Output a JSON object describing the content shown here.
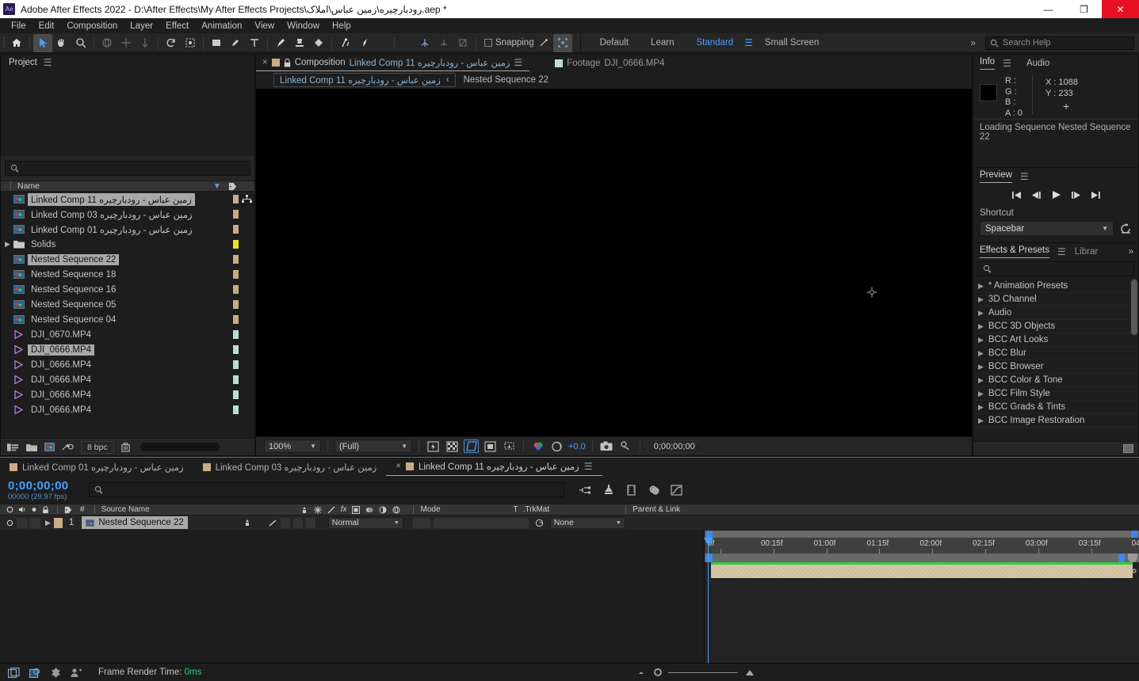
{
  "window": {
    "title": "Adobe After Effects 2022 - D:\\After Effects\\My After Effects Projects\\رودبارچیره\\زمین عباس\\املاک.aep *",
    "logo": "Ae",
    "minimize": "—",
    "maximize": "❐",
    "close": "✕"
  },
  "menubar": {
    "items": [
      "File",
      "Edit",
      "Composition",
      "Layer",
      "Effect",
      "Animation",
      "View",
      "Window",
      "Help"
    ]
  },
  "toolbar": {
    "snapping_label": "Snapping",
    "workspaces": [
      {
        "label": "Default",
        "current": false
      },
      {
        "label": "Learn",
        "current": false
      },
      {
        "label": "Standard",
        "current": true
      },
      {
        "label": "Small Screen",
        "current": false
      }
    ],
    "overflow": "»"
  },
  "search_help": {
    "placeholder": "Search Help",
    "value": "Search Help"
  },
  "project": {
    "tab_label": "Project",
    "menu_icon": "hamburger-icon",
    "search_placeholder": "",
    "column_header": "Name",
    "items": [
      {
        "name": "زمین عباس - رودبارچیره Linked Comp 11",
        "type": "comp",
        "label_color": "#c9ab85",
        "selected": true,
        "rtl": true
      },
      {
        "name": "زمین عباس - رودبارچیره Linked Comp 03",
        "type": "comp",
        "label_color": "#c9ab85",
        "selected": false,
        "rtl": true
      },
      {
        "name": "زمین عباس - رودبارچیره Linked Comp 01",
        "type": "comp",
        "label_color": "#c9ab85",
        "selected": false,
        "rtl": true
      },
      {
        "name": "Solids",
        "type": "folder",
        "label_color": "#ece02c",
        "selected": false,
        "rtl": false
      },
      {
        "name": "Nested Sequence 22",
        "type": "comp",
        "label_color": "#c9ab85",
        "selected": true,
        "rtl": false
      },
      {
        "name": "Nested Sequence 18",
        "type": "comp",
        "label_color": "#c9ab85",
        "selected": false,
        "rtl": false
      },
      {
        "name": "Nested Sequence 16",
        "type": "comp",
        "label_color": "#c9ab85",
        "selected": false,
        "rtl": false
      },
      {
        "name": "Nested Sequence 05",
        "type": "comp",
        "label_color": "#c9ab85",
        "selected": false,
        "rtl": false
      },
      {
        "name": "Nested Sequence 04",
        "type": "comp",
        "label_color": "#c9ab85",
        "selected": false,
        "rtl": false
      },
      {
        "name": "DJI_0670.MP4",
        "type": "footage",
        "label_color": "#b9ded9",
        "selected": false,
        "rtl": false
      },
      {
        "name": "DJI_0666.MP4",
        "type": "footage",
        "label_color": "#b9ded9",
        "selected": true,
        "rtl": false
      },
      {
        "name": "DJI_0666.MP4",
        "type": "footage",
        "label_color": "#b9ded9",
        "selected": false,
        "rtl": false
      },
      {
        "name": "DJI_0666.MP4",
        "type": "footage",
        "label_color": "#b9ded9",
        "selected": false,
        "rtl": false
      },
      {
        "name": "DJI_0666.MP4",
        "type": "footage",
        "label_color": "#b9ded9",
        "selected": false,
        "rtl": false
      },
      {
        "name": "DJI_0666.MP4",
        "type": "footage",
        "label_color": "#b9ded9",
        "selected": false,
        "rtl": false
      }
    ],
    "bottom": {
      "bit_depth": "8 bpc"
    }
  },
  "composition": {
    "tabs": [
      {
        "prefix": "Composition",
        "label": "زمین عباس - رودبارچیره Linked Comp 11",
        "active": true,
        "closable": true,
        "locked": true,
        "swatch": "#c9ab85"
      },
      {
        "prefix": "Footage",
        "label": "DJI_0666.MP4",
        "active": false,
        "closable": false,
        "locked": false,
        "swatch": "#b9ded9"
      }
    ],
    "breadcrumb": {
      "chip": "زمین عباس - رودبارچیره Linked Comp 11",
      "arrow": "‹",
      "next": "Nested Sequence 22"
    },
    "viewer_bar": {
      "zoom": "100%",
      "resolution": "(Full)",
      "exposure": "+0.0",
      "timecode": "0;00;00;00"
    }
  },
  "info_panel": {
    "tabs": [
      {
        "label": "Info",
        "active": true
      },
      {
        "label": "Audio",
        "active": false
      }
    ],
    "channels": [
      {
        "key": "R :",
        "value": ""
      },
      {
        "key": "G :",
        "value": ""
      },
      {
        "key": "B :",
        "value": ""
      },
      {
        "key": "A :",
        "value": "0"
      }
    ],
    "coords": [
      {
        "key": "X :",
        "value": "1088"
      },
      {
        "key": "Y :",
        "value": "233"
      }
    ],
    "status": "Loading Sequence Nested Sequence 22"
  },
  "preview_panel": {
    "tab_label": "Preview",
    "transport": [
      "first-frame-icon",
      "prev-frame-icon",
      "play-icon",
      "next-frame-icon",
      "last-frame-icon"
    ],
    "shortcut_label": "Shortcut",
    "shortcut_value": "Spacebar",
    "reset_icon": "reset-icon"
  },
  "effects_panel": {
    "tabs": [
      {
        "label": "Effects & Presets",
        "active": true
      },
      {
        "label": "Librar",
        "active": false
      }
    ],
    "overflow": "»",
    "search_placeholder": "",
    "categories": [
      "* Animation Presets",
      "3D Channel",
      "Audio",
      "BCC 3D Objects",
      "BCC Art Looks",
      "BCC Blur",
      "BCC Browser",
      "BCC Color & Tone",
      "BCC Film Style",
      "BCC Grads & Tints",
      "BCC Image Restoration"
    ]
  },
  "timeline": {
    "tabs": [
      {
        "label": "زمین عباس - رودبارچیره Linked Comp 01",
        "active": false,
        "closable": false,
        "swatch": "#c9ab85"
      },
      {
        "label": "زمین عباس - رودبارچیره Linked Comp 03",
        "active": false,
        "closable": false,
        "swatch": "#c9ab85"
      },
      {
        "label": "زمین عباس - رودبارچیره Linked Comp 11",
        "active": true,
        "closable": true,
        "swatch": "#c9ab85"
      }
    ],
    "current_time": "0;00;00;00",
    "frame_info": "00000 (29.97 fps)",
    "search_placeholder": "",
    "columns": [
      "Source Name",
      "Mode",
      "T",
      "TrkMat",
      "Parent & Link"
    ],
    "col_hash": "#",
    "layers": [
      {
        "index": "1",
        "name": "Nested Sequence 22",
        "mode": "Normal",
        "trkmat": "",
        "parent": "None",
        "label_color": "#c9ab85"
      }
    ],
    "ruler_ticks": [
      "0f",
      "00:15f",
      "01:00f",
      "01:15f",
      "02:00f",
      "02:15f",
      "03:00f",
      "03:15f",
      "04"
    ],
    "status": {
      "label": "Frame Render Time:",
      "value": "0ms"
    }
  },
  "colors": {
    "accent_blue": "#4a9eff",
    "label_comp": "#c9ab85",
    "label_footage": "#b9ded9",
    "label_solid": "#ece02c",
    "green_bar": "#2ecc40",
    "close_red": "#e81123"
  }
}
